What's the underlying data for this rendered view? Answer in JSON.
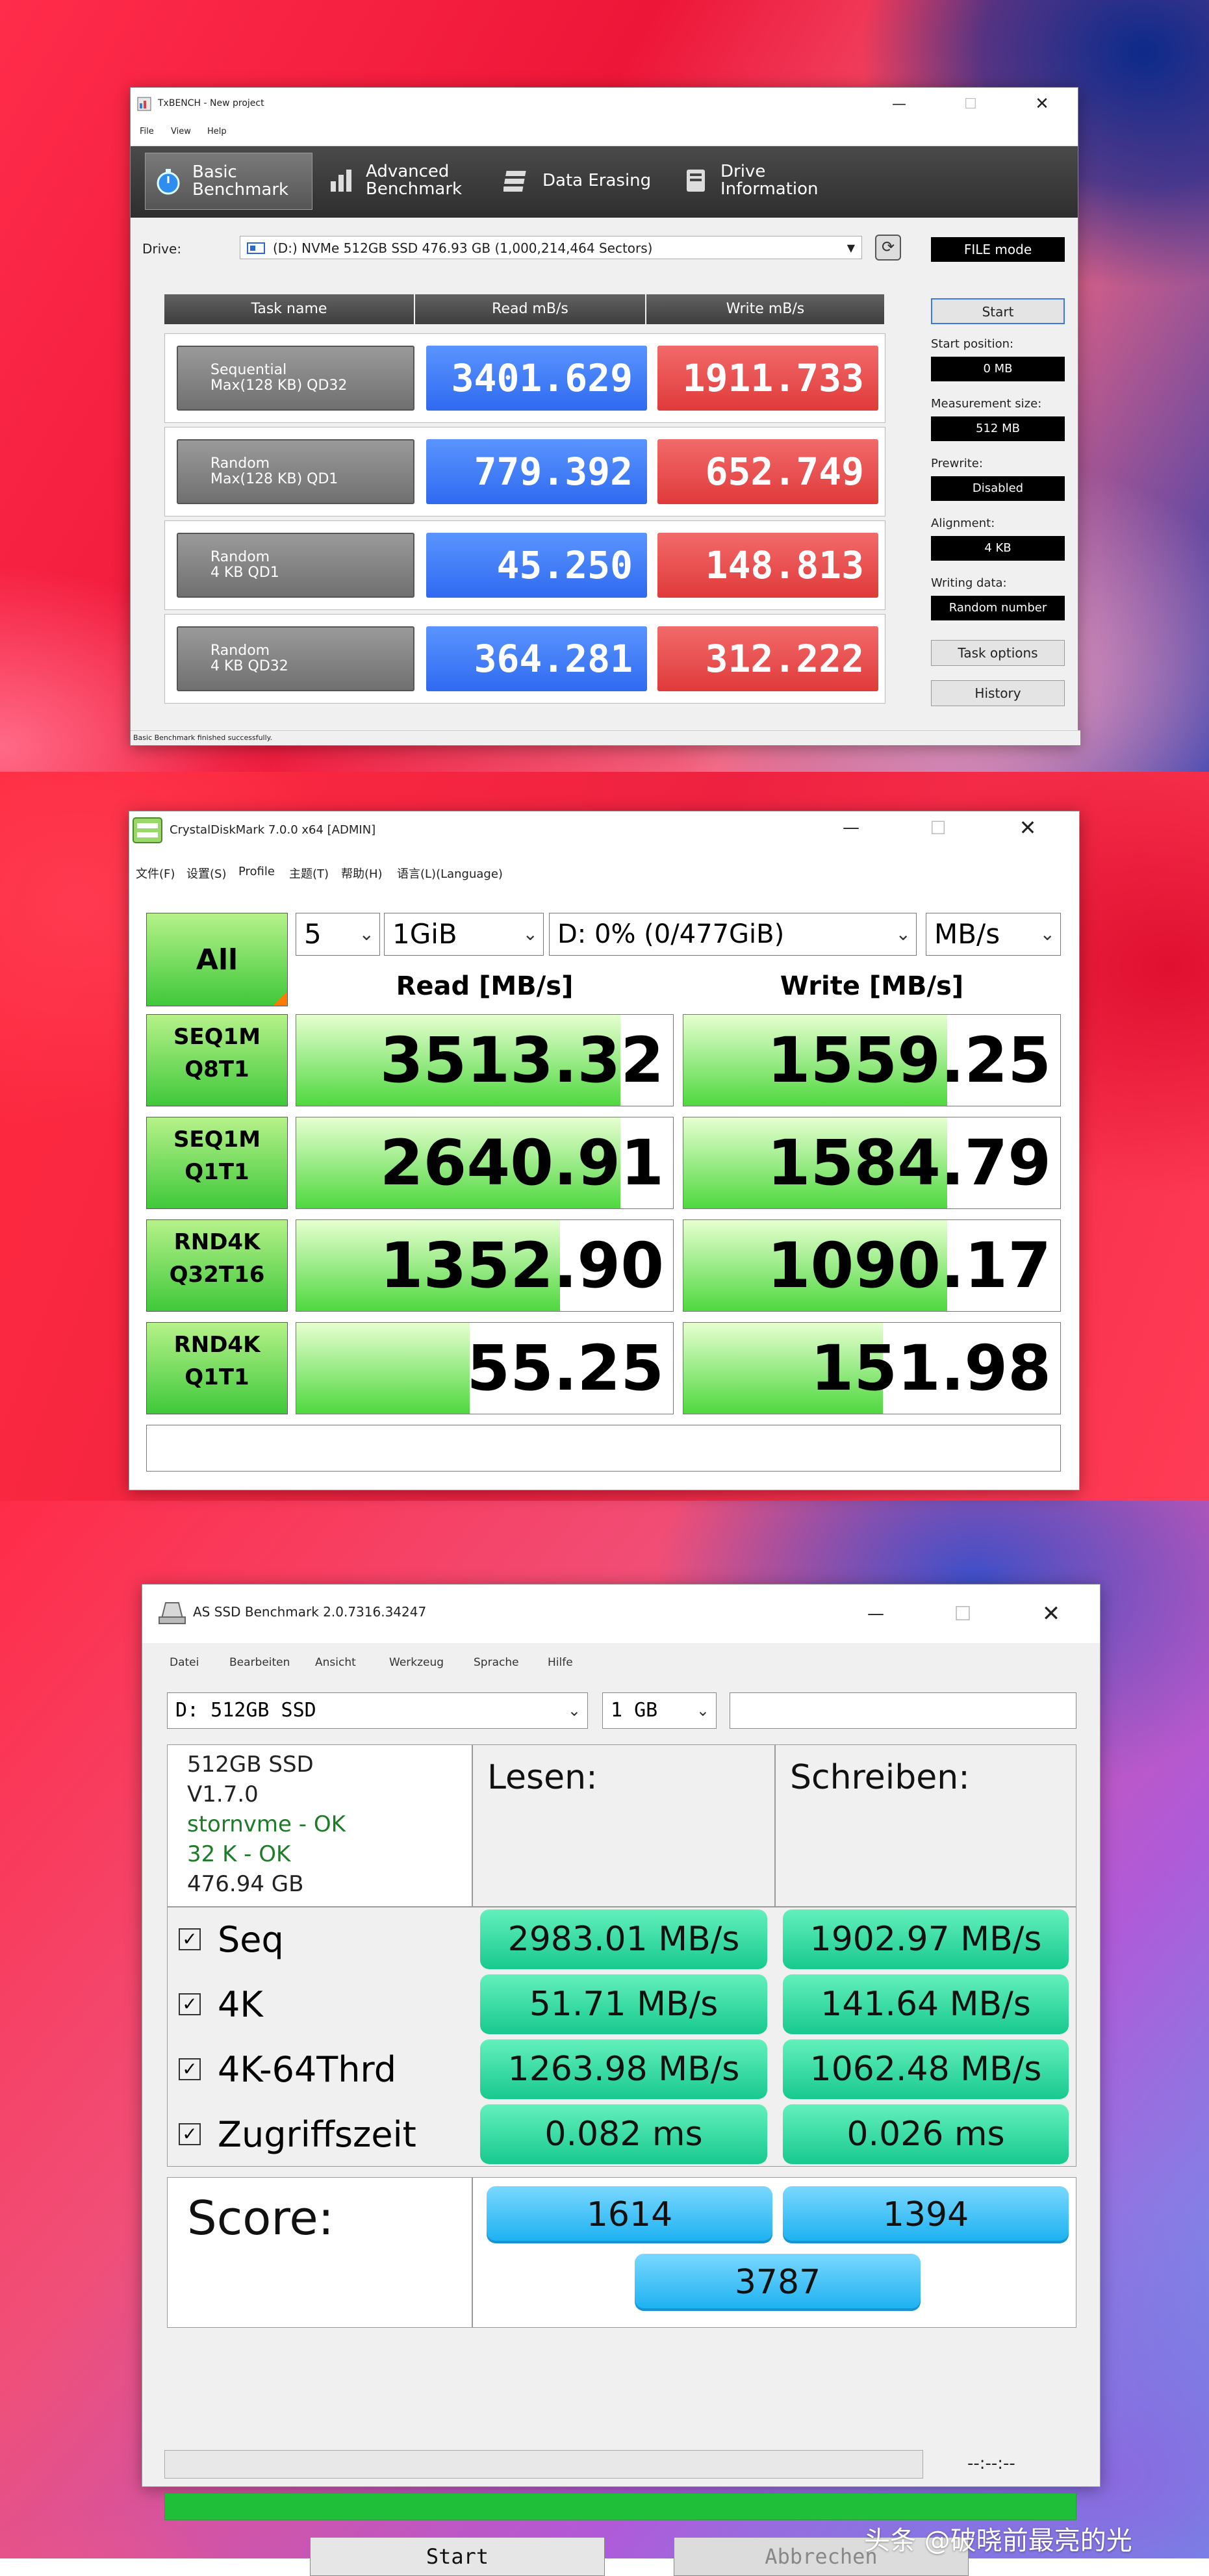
{
  "txbench": {
    "title": "TxBENCH - New project",
    "menu": [
      "File",
      "View",
      "Help"
    ],
    "tabs": [
      {
        "label_line1": "Basic",
        "label_line2": "Benchmark",
        "active": true
      },
      {
        "label_line1": "Advanced",
        "label_line2": "Benchmark",
        "active": false
      },
      {
        "label_line1": "Data Erasing",
        "label_line2": "",
        "active": false
      },
      {
        "label_line1": "Drive",
        "label_line2": "Information",
        "active": false
      }
    ],
    "drive_label": "Drive:",
    "drive_value": "(D:) NVMe 512GB SSD  476.93 GB (1,000,214,464 Sectors)",
    "mode": "FILE mode",
    "headers": {
      "task": "Task name",
      "read": "Read mB/s",
      "write": "Write mB/s"
    },
    "rows": [
      {
        "name1": "Sequential",
        "name2": "Max(128 KB) QD32",
        "read": "3401.629",
        "write": "1911.733"
      },
      {
        "name1": "Random",
        "name2": "Max(128 KB) QD1",
        "read": "779.392",
        "write": "652.749"
      },
      {
        "name1": "Random",
        "name2": "4 KB QD1",
        "read": "45.250",
        "write": "148.813"
      },
      {
        "name1": "Random",
        "name2": "4 KB QD32",
        "read": "364.281",
        "write": "312.222"
      }
    ],
    "side": {
      "start_button": "Start",
      "start_position_label": "Start position:",
      "start_position": "0 MB",
      "measurement_size_label": "Measurement size:",
      "measurement_size": "512 MB",
      "prewrite_label": "Prewrite:",
      "prewrite": "Disabled",
      "alignment_label": "Alignment:",
      "alignment": "4 KB",
      "writing_data_label": "Writing data:",
      "writing_data": "Random number",
      "task_options_button": "Task options",
      "history_button": "History"
    },
    "status": "Basic Benchmark finished successfully."
  },
  "cdm": {
    "title": "CrystalDiskMark 7.0.0 x64 [ADMIN]",
    "menu": [
      "文件(F)",
      "设置(S)",
      "Profile",
      "主题(T)",
      "帮助(H)",
      "语言(L)(Language)"
    ],
    "all_button": "All",
    "count": "5",
    "size": "1GiB",
    "drive": "D: 0% (0/477GiB)",
    "unit": "MB/s",
    "read_header": "Read [MB/s]",
    "write_header": "Write [MB/s]",
    "rows": [
      {
        "l1": "SEQ1M",
        "l2": "Q8T1",
        "read": "3513.32",
        "write": "1559.25",
        "read_frac": 0.86,
        "write_frac": 0.7
      },
      {
        "l1": "SEQ1M",
        "l2": "Q1T1",
        "read": "2640.91",
        "write": "1584.79",
        "read_frac": 0.86,
        "write_frac": 0.7
      },
      {
        "l1": "RND4K",
        "l2": "Q32T16",
        "read": "1352.90",
        "write": "1090.17",
        "read_frac": 0.7,
        "write_frac": 0.7
      },
      {
        "l1": "RND4K",
        "l2": "Q1T1",
        "read": "55.25",
        "write": "151.98",
        "read_frac": 0.46,
        "write_frac": 0.53
      }
    ]
  },
  "asssd": {
    "title": "AS SSD Benchmark 2.0.7316.34247",
    "menu": [
      "Datei",
      "Bearbeiten",
      "Ansicht",
      "Werkzeug",
      "Sprache",
      "Hilfe"
    ],
    "drive_select": "D: 512GB SSD",
    "size_select": "1 GB",
    "info": [
      "512GB SSD",
      "V1.7.0",
      "stornvme - OK",
      "32 K - OK",
      "476.94 GB"
    ],
    "read_header": "Lesen:",
    "write_header": "Schreiben:",
    "rows": [
      {
        "label": "Seq",
        "read": "2983.01 MB/s",
        "write": "1902.97 MB/s"
      },
      {
        "label": "4K",
        "read": "51.71 MB/s",
        "write": "141.64 MB/s"
      },
      {
        "label": "4K-64Thrd",
        "read": "1263.98 MB/s",
        "write": "1062.48 MB/s"
      },
      {
        "label": "Zugriffszeit",
        "read": "0.082 ms",
        "write": "0.026 ms"
      }
    ],
    "score_label": "Score:",
    "score_read": "1614",
    "score_write": "1394",
    "score_total": "3787",
    "time": "--:--:--",
    "start_button": "Start",
    "cancel_button": "Abbrechen"
  },
  "watermark": "头条 @破晓前最亮的光"
}
